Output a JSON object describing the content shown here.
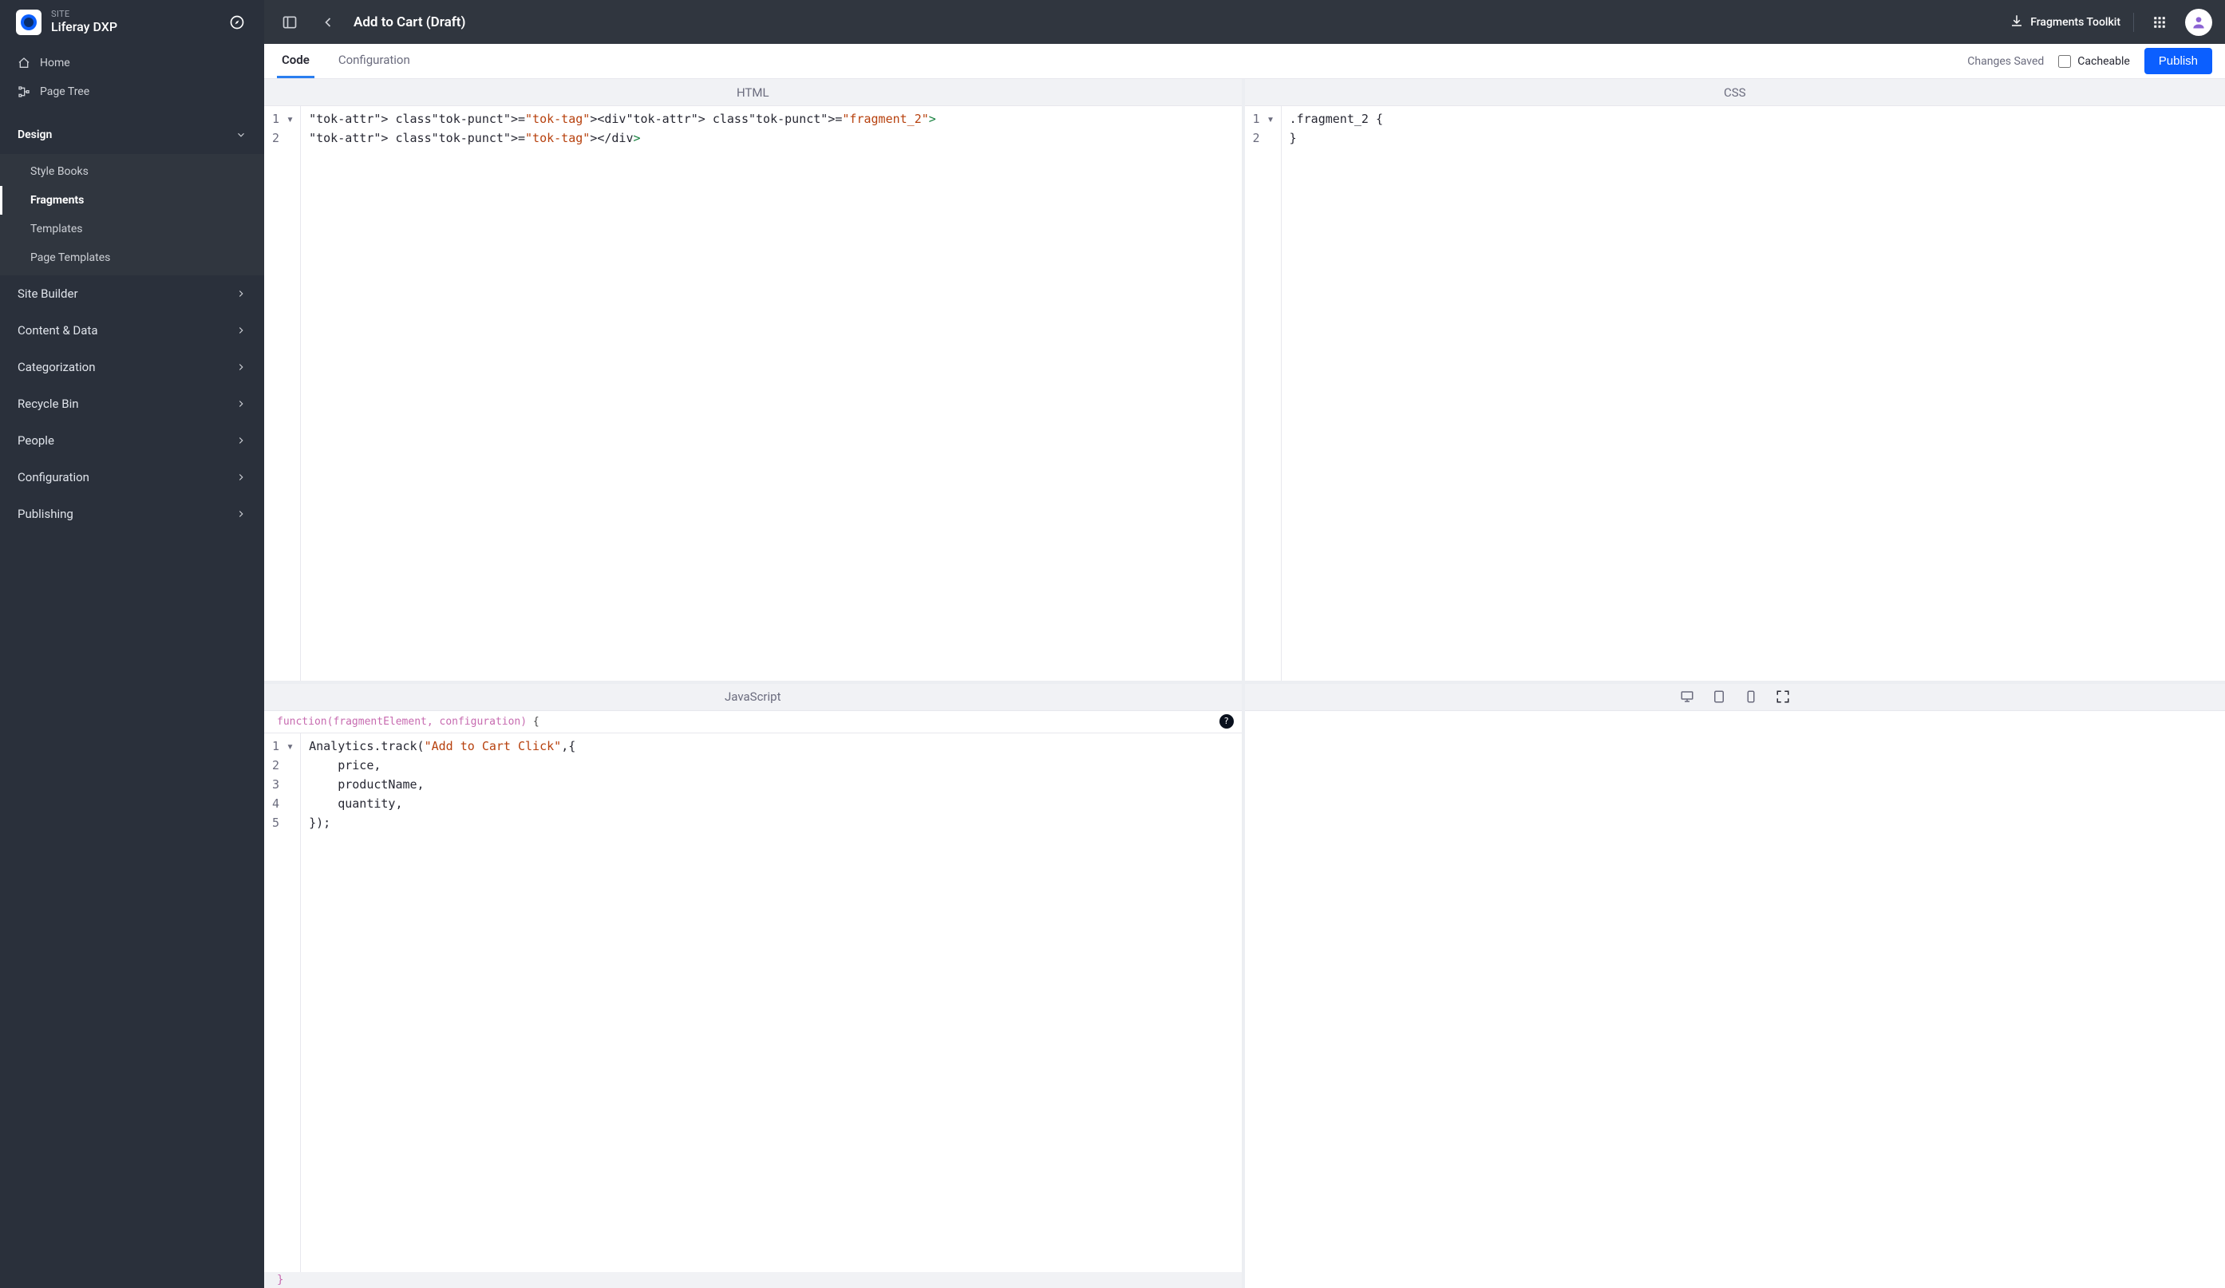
{
  "site": {
    "label": "SITE",
    "name": "Liferay DXP"
  },
  "sidebar": {
    "quick": [
      {
        "icon": "home-icon",
        "label": "Home"
      },
      {
        "icon": "page-tree-icon",
        "label": "Page Tree"
      }
    ],
    "expanded_section": {
      "label": "Design",
      "items": [
        {
          "label": "Style Books",
          "active": false
        },
        {
          "label": "Fragments",
          "active": true
        },
        {
          "label": "Templates",
          "active": false
        },
        {
          "label": "Page Templates",
          "active": false
        }
      ]
    },
    "sections": [
      {
        "label": "Site Builder"
      },
      {
        "label": "Content & Data"
      },
      {
        "label": "Categorization"
      },
      {
        "label": "Recycle Bin"
      },
      {
        "label": "People"
      },
      {
        "label": "Configuration"
      },
      {
        "label": "Publishing"
      }
    ]
  },
  "topbar": {
    "title": "Add to Cart (Draft)",
    "import_label": "Fragments Toolkit"
  },
  "subtoolbar": {
    "tabs": [
      {
        "label": "Code",
        "active": true
      },
      {
        "label": "Configuration",
        "active": false
      }
    ],
    "status": "Changes Saved",
    "cacheable_label": "Cacheable",
    "cacheable_checked": false,
    "publish_label": "Publish"
  },
  "editors": {
    "html": {
      "header": "HTML",
      "lines": [
        "<div class=\"fragment_2\">",
        "</div>"
      ]
    },
    "css": {
      "header": "CSS",
      "lines": [
        ".fragment_2 {",
        "}"
      ]
    },
    "js": {
      "header": "JavaScript",
      "decl": "function(fragmentElement, configuration) {",
      "close": "}",
      "lines": [
        "Analytics.track(\"Add to Cart Click\",{",
        "    price,",
        "    productName,",
        "    quantity,",
        "});"
      ]
    }
  }
}
